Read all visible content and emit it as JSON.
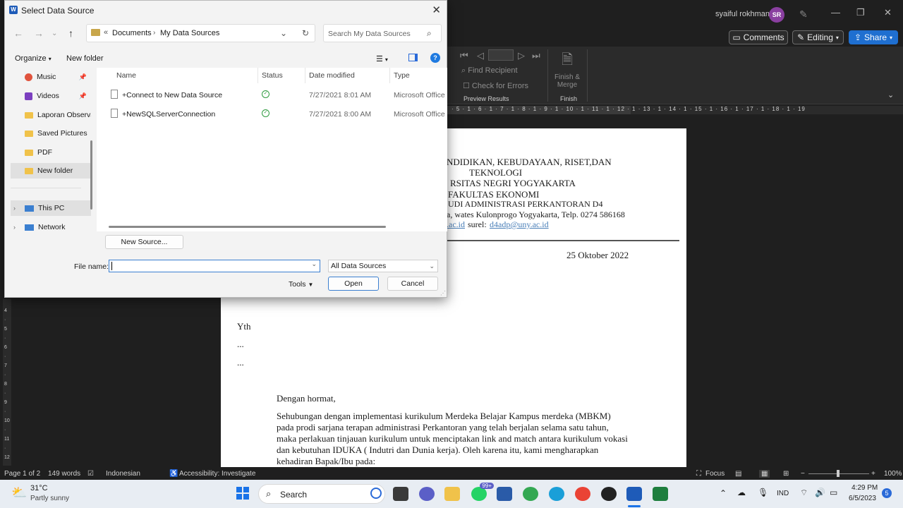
{
  "word": {
    "user_name": "syaiful rokhman",
    "user_initials": "SR",
    "comments_label": "Comments",
    "editing_label": "Editing",
    "share_label": "Share",
    "ribbon": {
      "find_recipient": "Find Recipient",
      "check_errors": "Check for Errors",
      "preview_results_group": "Preview Results",
      "finish_merge": "Finish &",
      "finish_merge_2": "Merge",
      "finish_group": "Finish"
    },
    "ruler_text": "· 5 · 1 · 6 · 1 · 7 · 1 · 8 · 1 · 9 · 1 · 10 · 1 · 11 · 1 · 12 · 1 · 13 · 1 · 14 · 1 · 15 · 1 · 16 · 1 · 17 · 1 · 18 · 1 · 19",
    "vruler_text": "4 · 5 · 6 · 7 · 8 · 9 · 10 · 11 · 12"
  },
  "document": {
    "header_lines": [
      "NDIDIKAN, KEBUDAYAAN, RISET,DAN",
      "TEKNOLOGI",
      "RSITAS NEGRI YOGYAKARTA",
      "FAKULTAS EKONOMI",
      "UDI ADMINISTRASI PERKANTORAN D4",
      "a, wates Kulonprogo Yogyakarta, Telp. 0274 586168"
    ],
    "link_1": ".ac.id",
    "surel_label": "surel:",
    "link_2": "d4adp@uny.ac.id",
    "date": "25 Oktober 2022",
    "yth": "Yth",
    "dots_1": "...",
    "dots_2": "...",
    "greeting": "Dengan hormat,",
    "paragraph": "Sehubungan dengan implementasi kurikulum Merdeka Belajar Kampus merdeka (MBKM) pada prodi sarjana terapan administrasi Perkantoran yang telah berjalan selama satu tahun, maka perlakuan tinjauan kurikulum untuk menciptakan link and match antara kurikulum vokasi dan kebutuhan IDUKA ( Indutri dan Dunia kerja). Oleh karena itu, kami mengharapkan kehadiran Bapak/Ibu pada:"
  },
  "statusbar": {
    "page": "Page 1 of 2",
    "words": "149 words",
    "language": "Indonesian",
    "accessibility": "Accessibility: Investigate",
    "focus": "Focus",
    "zoom": "100%"
  },
  "dialog": {
    "title": "Select Data Source",
    "breadcrumb": [
      "Documents",
      "My Data Sources"
    ],
    "search_placeholder": "Search My Data Sources",
    "organize": "Organize",
    "new_folder": "New folder",
    "nav_items": [
      {
        "label": "Music",
        "icon": "music-icon",
        "color": "#e0533d"
      },
      {
        "label": "Videos",
        "icon": "video-icon",
        "color": "#7b3fbf"
      },
      {
        "label": "Laporan Observasi",
        "icon": "folder-icon",
        "color": "#f0c24a"
      },
      {
        "label": "Saved Pictures",
        "icon": "folder-icon",
        "color": "#f0c24a"
      },
      {
        "label": "PDF",
        "icon": "folder-icon",
        "color": "#f0c24a"
      },
      {
        "label": "New folder",
        "icon": "folder-icon",
        "color": "#f0c24a"
      },
      {
        "label": "This PC",
        "icon": "pc-icon",
        "color": "#3b7fd0"
      },
      {
        "label": "Network",
        "icon": "network-icon",
        "color": "#3b7fd0"
      }
    ],
    "columns": [
      "Name",
      "Status",
      "Date modified",
      "Type"
    ],
    "files": [
      {
        "name": "+Connect to New Data Source",
        "date": "7/27/2021 8:01 AM",
        "type": "Microsoft Office"
      },
      {
        "name": "+NewSQLServerConnection",
        "date": "7/27/2021 8:00 AM",
        "type": "Microsoft Office"
      }
    ],
    "new_source": "New Source...",
    "file_name_label": "File name:",
    "file_name_value": "",
    "filter_value": "All Data Sources",
    "tools_label": "Tools",
    "open_label": "Open",
    "cancel_label": "Cancel"
  },
  "taskbar": {
    "temperature": "31°C",
    "weather": "Partly sunny",
    "search_label": "Search",
    "whatsapp_badge": "99+",
    "language": "IND",
    "time": "4:29 PM",
    "date": "6/5/2023",
    "notif_count": "5"
  }
}
